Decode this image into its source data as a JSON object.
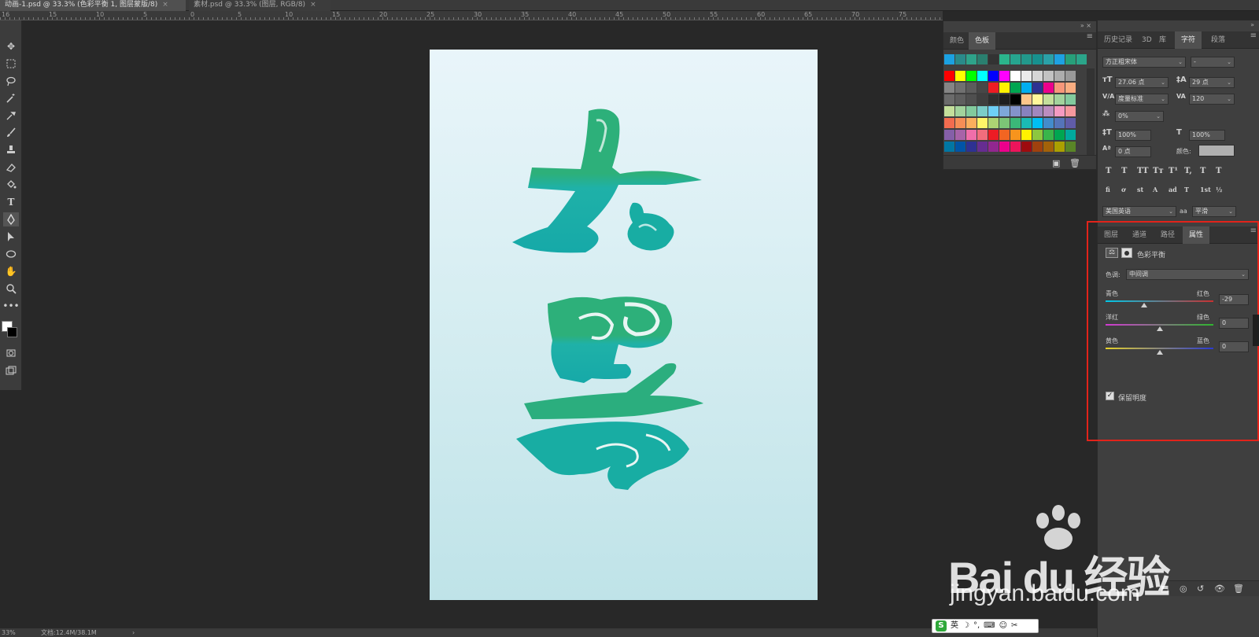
{
  "tabs": [
    {
      "label": "动画-1.psd @ 33.3% (色彩平衡 1, 图层蒙版/8)",
      "active": true
    },
    {
      "label": "素材.psd @ 33.3% (图层, RGB/8)",
      "active": false
    }
  ],
  "ruler": {
    "marks": [
      "16",
      "15",
      "10",
      "5",
      "0",
      "5",
      "10",
      "15",
      "20",
      "25",
      "30",
      "35",
      "40",
      "45",
      "50",
      "55",
      "60",
      "65",
      "70",
      "75"
    ]
  },
  "status": {
    "zoom": "33%",
    "doc": "文档:12.4M/38.1M",
    "arrow": "›"
  },
  "swatches_panel": {
    "tabs": [
      "颜色",
      "色板"
    ],
    "active_tab": "色板",
    "colors": [
      [
        "#1ba1e2",
        "#2a8a8a",
        "#2ea38a",
        "#2a7f6f",
        "#333333",
        "#2bb58c",
        "#26a58f",
        "#22998c",
        "#17918f",
        "#2aa1a8",
        "#1ea1e2",
        "#27a07a",
        "#2ba58a"
      ],
      [
        "#ff0000",
        "#ffff00",
        "#00ff00",
        "#00ffff",
        "#0000ff",
        "#ff00ff",
        "#ffffff",
        "#ebebeb",
        "#d6d6d6",
        "#c2c2c2",
        "#adadad",
        "#999999"
      ],
      [
        "#858585",
        "#707070",
        "#5c5c5c",
        "#474747",
        "#ed1c24",
        "#fff200",
        "#00a651",
        "#00aeef",
        "#2e3192",
        "#ec008c",
        "#f7977a",
        "#f9ad81"
      ],
      [
        "#6b6b6b",
        "#5e5e5e",
        "#4f4f4f",
        "#3f3f3f",
        "#2f2f2f",
        "#1f1f1f",
        "#000000",
        "#fdc68a",
        "#fff79a",
        "#c4df9b",
        "#a2d39c",
        "#82ca9d"
      ],
      [
        "#c4df9b",
        "#a2d39c",
        "#82ca9d",
        "#7bcdc8",
        "#6ecff6",
        "#7ea7d8",
        "#8493ca",
        "#8882be",
        "#a187be",
        "#bc8dbf",
        "#f49ac1",
        "#f5989d"
      ],
      [
        "#f26c4f",
        "#f68e56",
        "#fbaf5d",
        "#fff568",
        "#acd373",
        "#7cc576",
        "#3bb878",
        "#1abbb4",
        "#00bff3",
        "#438ccb",
        "#5574b9",
        "#605ca8"
      ],
      [
        "#855fa8",
        "#a763a8",
        "#f06eaa",
        "#f26d7d",
        "#ed1c24",
        "#f26522",
        "#f7941d",
        "#fff200",
        "#8dc73f",
        "#39b54a",
        "#00a651",
        "#00a99d"
      ],
      [
        "#0076a3",
        "#0054a6",
        "#2e3192",
        "#662d91",
        "#92278f",
        "#ec008c",
        "#ed145b",
        "#9e0b0f",
        "#a0410d",
        "#a36209",
        "#aba000",
        "#598527"
      ]
    ]
  },
  "character_panel": {
    "tabs": [
      "历史记录",
      "3D",
      "库",
      "字符",
      "段落"
    ],
    "active_tab": "字符",
    "font_family": "方正粗宋体",
    "font_style": "-",
    "font_size": "27.06 点",
    "leading": "29 点",
    "kerning": "度量标准",
    "tracking": "120",
    "scale_pct": "0%",
    "vscale": "100%",
    "hscale": "100%",
    "baseline": "0 点",
    "color_label": "颜色:",
    "color_value": "#b0b0b0",
    "style_buttons": [
      "T",
      "T",
      "TT",
      "Tт",
      "T¹",
      "T,",
      "T",
      "T"
    ],
    "opentype_buttons": [
      "fi",
      "ơ",
      "st",
      "A",
      "ad",
      "T",
      "1st",
      "½"
    ],
    "language": "美国英语",
    "antialias_label": "aa",
    "antialias": "平滑"
  },
  "properties_panel": {
    "tabs": [
      "图层",
      "通道",
      "路径",
      "属性"
    ],
    "active_tab": "属性",
    "title": "色彩平衡",
    "tone_label": "色调:",
    "tone_value": "中间调",
    "sliders": [
      {
        "left": "青色",
        "right": "红色",
        "value": "-29",
        "fraction": 0.355,
        "gradient": "linear-gradient(90deg,#00c8e8,#c83030)"
      },
      {
        "left": "洋红",
        "right": "绿色",
        "value": "0",
        "fraction": 0.5,
        "gradient": "linear-gradient(90deg,#d23ad2,#2fb52f)"
      },
      {
        "left": "黄色",
        "right": "蓝色",
        "value": "0",
        "fraction": 0.5,
        "gradient": "linear-gradient(90deg,#e6d22a,#2a3ad2)"
      }
    ],
    "preserve_luminosity": "保留明度",
    "preserve_checked": "✓"
  },
  "ime": {
    "logo": "S",
    "lang": "英",
    "icons": [
      "☽",
      "°,",
      "⌨",
      "☺",
      "✂"
    ]
  },
  "watermark": {
    "brand": "Bai du 经验",
    "url": "jingyan.baidu.com"
  }
}
